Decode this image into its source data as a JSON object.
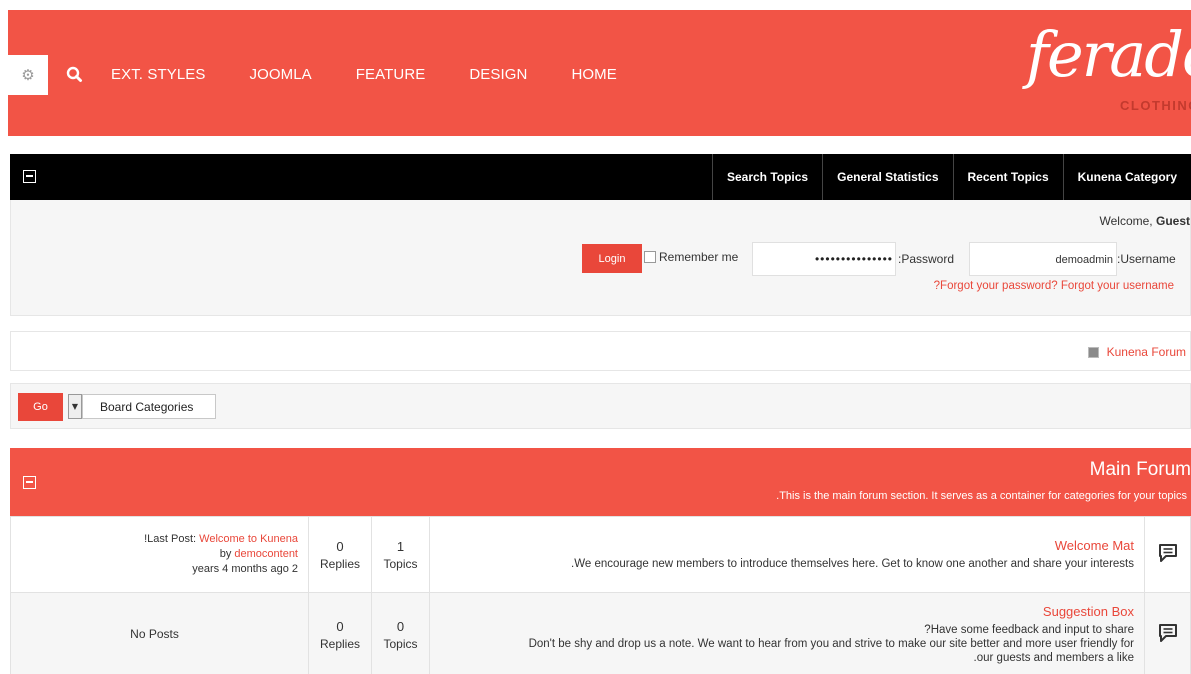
{
  "header": {
    "nav": [
      "EXT. STYLES",
      "JOOMLA",
      "FEATURE",
      "DESIGN",
      "HOME"
    ],
    "logo_text": "ferado",
    "logo_sub": "CLOTHING",
    "colors": {
      "brand": "#f25446",
      "toolbar": "#000000"
    },
    "icons": [
      "gear-icon",
      "search-icon"
    ]
  },
  "toolbar": {
    "items": [
      "Search Topics",
      "General Statistics",
      "Recent Topics",
      "Kunena Category"
    ]
  },
  "login": {
    "welcome_prefix": "Welcome, ",
    "welcome_user": "Guest",
    "login_button": "Login",
    "remember_label": "Remember me",
    "password_value": "•••••••••••••••",
    "password_label": ":Password",
    "username_value": "demoadmin",
    "username_label": ":Username",
    "forgot_text": "?Forgot your password? Forgot your username"
  },
  "breadcrumb": {
    "label": "Kunena Forum"
  },
  "jump": {
    "go_button": "Go",
    "selected": "Board Categories"
  },
  "forum": {
    "title": "Main Forum",
    "description": ".This is the main forum section. It serves as a container for categories for your topics",
    "rows": [
      {
        "last_post_prefix": "!Last Post: ",
        "last_post_link": "Welcome to Kunena",
        "by_prefix": "by ",
        "by_user": "democontent",
        "when": "years 4 months ago 2",
        "replies": "0",
        "replies_label": "Replies",
        "topics": "1",
        "topics_label": "Topics",
        "title": "Welcome Mat",
        "desc": ".We encourage new members to introduce themselves here. Get to know one another and share your interests"
      },
      {
        "no_posts": "No Posts",
        "replies": "0",
        "replies_label": "Replies",
        "topics": "0",
        "topics_label": "Topics",
        "title": "Suggestion Box",
        "desc_1": "?Have some feedback and input to share",
        "desc_2": "Don't be shy and drop us a note. We want to hear from you and strive to make our site better and more user friendly for",
        "desc_3": ".our guests and members a like"
      }
    ]
  }
}
